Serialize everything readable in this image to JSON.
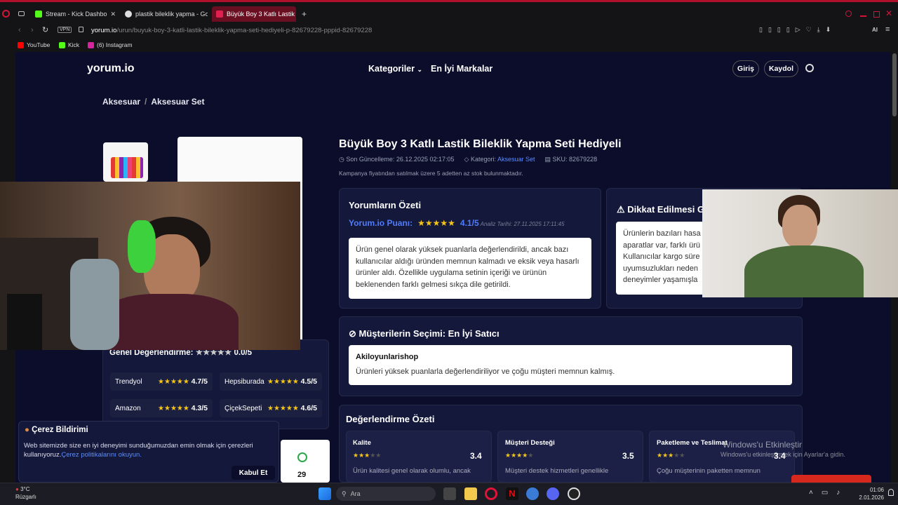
{
  "browser": {
    "tabs": [
      {
        "label": "Stream - Kick Dashbo",
        "favicon_color": "#53fc18"
      },
      {
        "label": "plastik bileklik yapma - Go",
        "favicon_color": "#dddddd"
      },
      {
        "label": "Büyük Boy 3 Katlı Lastik B",
        "favicon_color": "#c0143a"
      }
    ],
    "url_host": "yorum.io",
    "url_path": "/urun/buyuk-boy-3-katli-lastik-bileklik-yapma-seti-hediyeli-p-82679228-pppid-82679228",
    "vpn_label": "VPN",
    "ai_label": "AI",
    "bookmarks": [
      {
        "label": "YouTube",
        "color": "#ff0000"
      },
      {
        "label": "Kick",
        "color": "#53fc18"
      },
      {
        "label": "(6) Instagram",
        "color": "#d6249f"
      }
    ]
  },
  "site": {
    "logo": "yorum.io",
    "nav": {
      "categories": "Kategoriler",
      "brands": "En İyi Markalar"
    },
    "login": "Giriş",
    "signup": "Kaydol"
  },
  "breadcrumb": {
    "parent": "Aksesuar",
    "sep": "/",
    "current": "Aksesuar Set"
  },
  "product": {
    "title": "Büyük Boy 3 Katlı Lastik Bileklik Yapma Seti Hediyeli",
    "updated": "Son Güncelleme: 26.12.2025 02:17:05",
    "category_prefix": "Kategori:",
    "category": "Aksesuar Set",
    "sku": "SKU: 82679228",
    "stock_note": "Kampanya fiyatından satılmak üzere 5 adetten az stok bulunmaktadır."
  },
  "summary": {
    "title": "Yorumların Özeti",
    "score_label": "Yorum.io Puanı:",
    "score": "4.1/5",
    "score_value": 4.1,
    "analysis_date": "Analiz Tarihi: 27.11.2025 17:11:45",
    "text": "Ürün genel olarak yüksek puanlarla değerlendirildi, ancak bazı kullanıcılar aldığı üründen memnun kalmadı ve eksik veya hasarlı ürünler aldı. Özellikle uygulama setinin içeriği ve ürünün beklenenden farklı gelmesi sıkça dile getirildi."
  },
  "attention": {
    "title": "Dikkat Edilmesi G",
    "lines": [
      "Ürünlerin bazıları hasa",
      "aparatlar var, farklı ürü",
      "Kullanıcılar kargo süre",
      "uyumsuzlukları neden",
      "deneyimler yaşamışla"
    ]
  },
  "choice": {
    "title": "Müşterilerin Seçimi: En İyi Satıcı",
    "seller": "Akiloyunlarishop",
    "text": "Ürünleri yüksek puanlarla değerlendiriliyor ve çoğu müşteri memnun kalmış."
  },
  "overall": {
    "label": "Genel Değerlendirme:",
    "score": "0.0/5"
  },
  "stores": [
    {
      "name": "Trendyol",
      "score": "4.7/5"
    },
    {
      "name": "Hepsiburada",
      "score": "4.5/5"
    },
    {
      "name": "Amazon",
      "score": "4.3/5"
    },
    {
      "name": "ÇiçekSepeti",
      "score": "4.6/5"
    }
  ],
  "eval": {
    "title": "Değerlendirme Özeti",
    "items": [
      {
        "name": "Kalite",
        "score": "3.4",
        "text": "Ürün kalitesi genel olarak olumlu, ancak"
      },
      {
        "name": "Müşteri Desteği",
        "score": "3.5",
        "text": "Müşteri destek hizmetleri genellikle"
      },
      {
        "name": "Paketleme ve Teslimat",
        "score": "3.4",
        "text": "Çoğu müşterinin paketten memnun"
      }
    ]
  },
  "comments_count": "29",
  "cookie": {
    "title": "Çerez Bildirimi",
    "text": "Web sitemizde size en iyi deneyimi sunduğumuzdan emin olmak için çerezleri kullanıyoruz.",
    "link": "Çerez politikalarını okuyun.",
    "accept": "Kabul Et"
  },
  "watermark": {
    "line1": "Windows'u Etkinleştir",
    "line2": "Windows'u etkinleştirmek için Ayarlar'a gidin."
  },
  "taskbar": {
    "weather_temp": "3°C",
    "weather_label": "Rüzgarlı",
    "search_placeholder": "Ara",
    "time": "01:06",
    "date": "2.01.2026"
  }
}
